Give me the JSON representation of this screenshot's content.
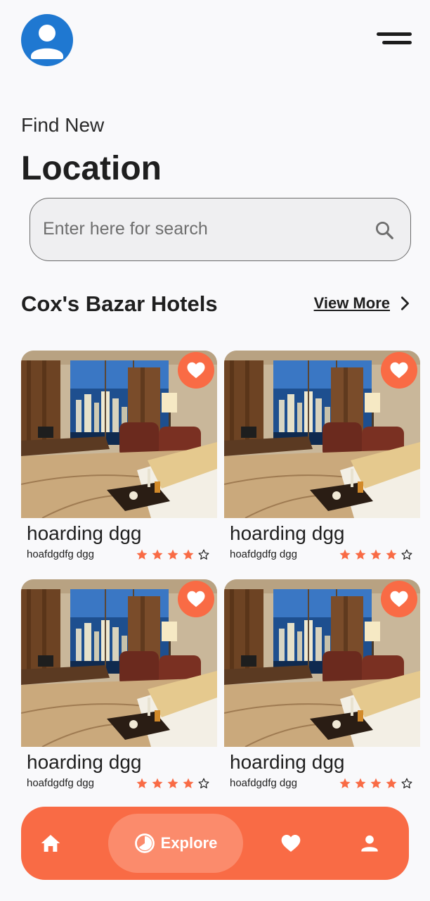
{
  "header": {
    "avatar_icon": "person-icon",
    "menu_icon": "menu-icon"
  },
  "hero": {
    "subtitle": "Find New",
    "title": "Location"
  },
  "search": {
    "placeholder": "Enter here for search",
    "value": "",
    "icon": "search-icon"
  },
  "section": {
    "title": "Cox's Bazar Hotels",
    "view_more_label": "View More"
  },
  "hotels": [
    {
      "name": "hoarding dgg",
      "subtitle": "hoafdgdfg dgg",
      "rating": 4,
      "max_rating": 5,
      "favorite": true
    },
    {
      "name": "hoarding dgg",
      "subtitle": "hoafdgdfg dgg",
      "rating": 4,
      "max_rating": 5,
      "favorite": true
    },
    {
      "name": "hoarding dgg",
      "subtitle": "hoafdgdfg dgg",
      "rating": 4,
      "max_rating": 5,
      "favorite": true
    },
    {
      "name": "hoarding dgg",
      "subtitle": "hoafdgdfg dgg",
      "rating": 4,
      "max_rating": 5,
      "favorite": true
    }
  ],
  "bottom_nav": {
    "active": "explore",
    "items": [
      {
        "id": "home",
        "icon": "home-icon",
        "label": ""
      },
      {
        "id": "explore",
        "icon": "explore-icon",
        "label": "Explore"
      },
      {
        "id": "favorites",
        "icon": "heart-icon",
        "label": ""
      },
      {
        "id": "profile",
        "icon": "person-icon",
        "label": ""
      }
    ]
  },
  "colors": {
    "accent": "#f96b45",
    "accent_light": "#fb8b6c",
    "avatar_bg": "#1f78d1",
    "star": "#f96b45",
    "background": "#f9f9fb"
  }
}
